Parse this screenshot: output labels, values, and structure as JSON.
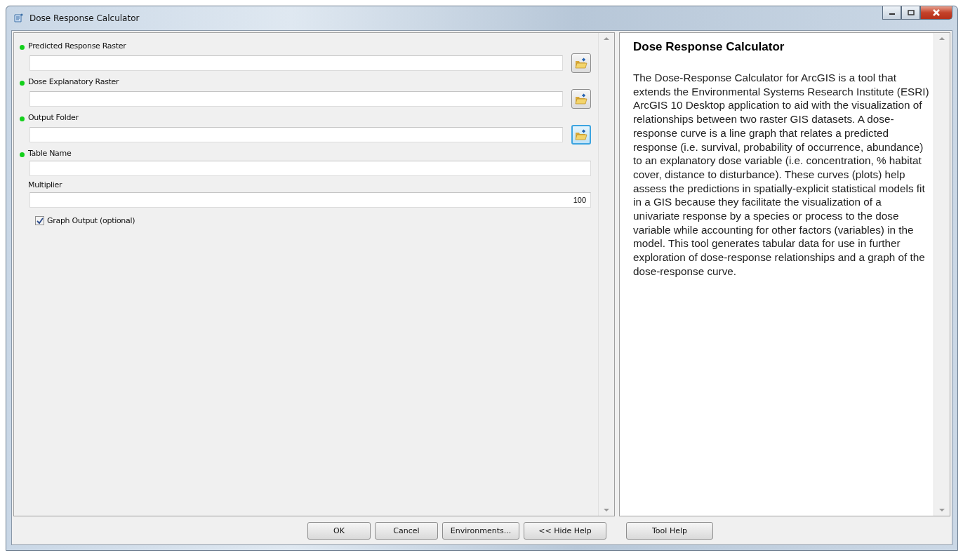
{
  "window": {
    "title": "Dose Response Calculator"
  },
  "parameters": [
    {
      "kind": "path",
      "label": "Predicted Response Raster",
      "required": true,
      "browse_focused": false
    },
    {
      "kind": "path",
      "label": "Dose Explanatory Raster",
      "required": true,
      "browse_focused": false
    },
    {
      "kind": "path",
      "label": "Output Folder",
      "required": true,
      "browse_focused": true
    },
    {
      "kind": "text",
      "label": "Table Name",
      "required": true
    },
    {
      "kind": "number",
      "label": "Multiplier",
      "required": false,
      "value": "100"
    },
    {
      "kind": "checkbox",
      "label": "Graph Output (optional)",
      "checked": true
    }
  ],
  "help": {
    "title": "Dose Response Calculator",
    "body": "The Dose-Response Calculator for ArcGIS is a tool that extends the Environmental Systems Research Institute (ESRI) ArcGIS 10 Desktop application to aid with the visualization of relationships between two raster GIS datasets. A dose-response curve is a line graph that relates a predicted response (i.e. survival, probability of occurrence, abundance) to an explanatory dose variable (i.e. concentration, % habitat cover, distance to disturbance). These curves (plots) help assess the predictions in spatially-explicit statistical models fit in a GIS because they facilitate the visualization of a univariate response by a species or process to the dose variable while accounting for other factors (variables) in the model. This tool generates tabular data for use in further exploration of dose-response relationships and a graph of the dose-response curve."
  },
  "buttons": [
    {
      "label": "OK"
    },
    {
      "label": "Cancel"
    },
    {
      "label": "Environments..."
    },
    {
      "label": "<< Hide Help"
    },
    {
      "label": "Tool Help"
    }
  ]
}
